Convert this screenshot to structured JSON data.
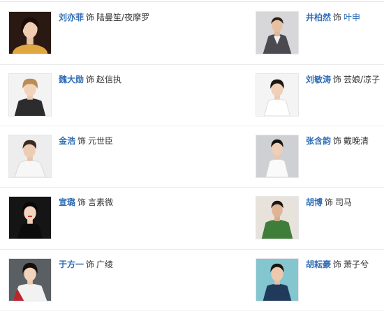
{
  "as_word": "饰",
  "cast": [
    {
      "actor": "刘亦菲",
      "role": "陆曼笙/夜摩罗",
      "role_is_link": false
    },
    {
      "actor": "井柏然",
      "role": "叶申",
      "role_is_link": true
    },
    {
      "actor": "魏大勋",
      "role": "赵信执",
      "role_is_link": false
    },
    {
      "actor": "刘敏涛",
      "role": "芸娘/凉子",
      "role_is_link": false
    },
    {
      "actor": "金浩",
      "role": "元世臣",
      "role_is_link": false
    },
    {
      "actor": "张含韵",
      "role": "戴晚清",
      "role_is_link": false
    },
    {
      "actor": "宣璐",
      "role": "言素微",
      "role_is_link": false
    },
    {
      "actor": "胡博",
      "role": "司马",
      "role_is_link": false
    },
    {
      "actor": "于方一",
      "role": "广绫",
      "role_is_link": false
    },
    {
      "actor": "胡耘豪",
      "role": "萧子兮",
      "role_is_link": false
    }
  ],
  "colors": {
    "link": "#2f6db5",
    "text": "#333333",
    "divider": "#ececec"
  }
}
